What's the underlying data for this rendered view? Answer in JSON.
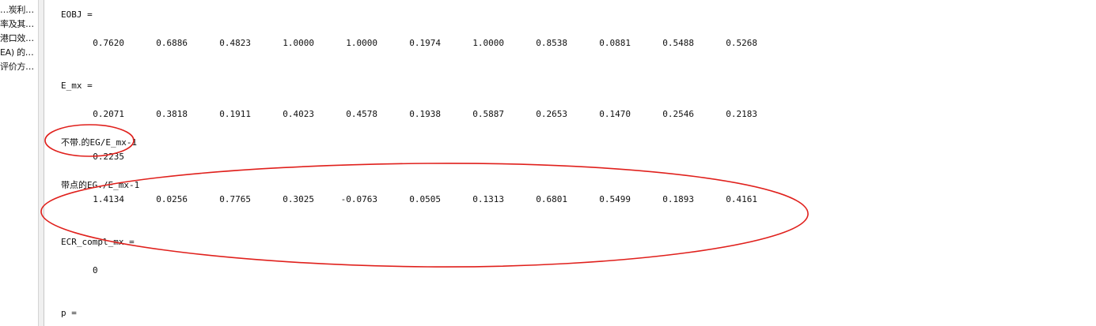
{
  "file_panel": {
    "items": [
      "…炭利…",
      "率及其…",
      "港口效…",
      "EA) 的…",
      "评价方…"
    ]
  },
  "command_window": {
    "eobj": {
      "label": "EOBJ =",
      "values": [
        "0.7620",
        "0.6886",
        "0.4823",
        "1.0000",
        "1.0000",
        "0.1974",
        "1.0000",
        "0.8538",
        "0.0881",
        "0.5488",
        "0.5268"
      ]
    },
    "e_mx": {
      "label": "E_mx =",
      "values": [
        "0.2071",
        "0.3818",
        "0.1911",
        "0.4023",
        "0.4578",
        "0.1938",
        "0.5887",
        "0.2653",
        "0.1470",
        "0.2546",
        "0.2183"
      ]
    },
    "no_dot_line": {
      "prefix": "不带.的",
      "expr": "EG/E_mx-1",
      "value": "0.2235"
    },
    "dot_line": {
      "prefix": "带点的",
      "expr": "EG./E_mx-1",
      "values": [
        "1.4134",
        "0.0256",
        "0.7765",
        "0.3025",
        "-0.0763",
        "0.0505",
        "0.1313",
        "0.6801",
        "0.5499",
        "0.1893",
        "0.4161"
      ]
    },
    "ecr": {
      "label": "ECR_compl_mx =",
      "value": "0"
    },
    "p": {
      "label": "p ="
    }
  },
  "annotation": {
    "color": "#e0201c"
  }
}
